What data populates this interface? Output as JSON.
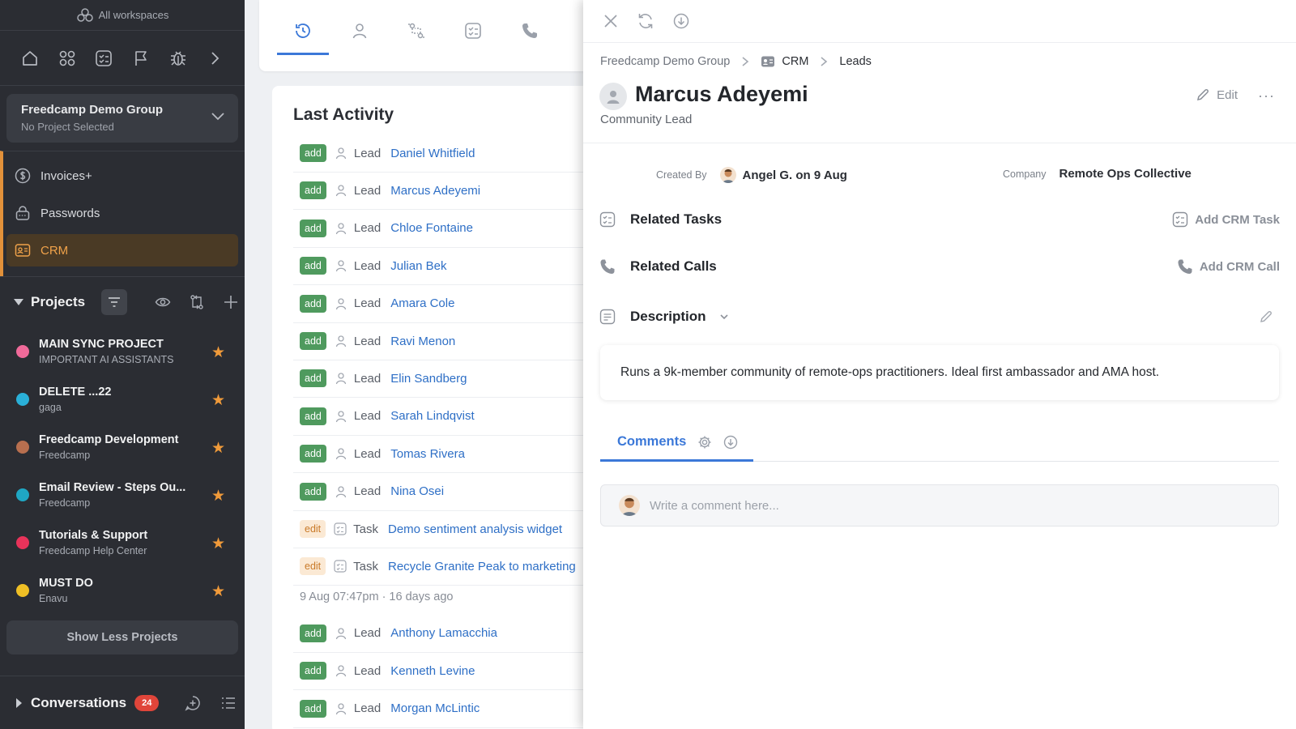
{
  "sidebar": {
    "workspaces_label": "All workspaces",
    "workspace": {
      "name": "Freedcamp Demo Group",
      "project": "No Project Selected"
    },
    "apps": [
      {
        "label": "Invoices+",
        "icon": "dollar-icon"
      },
      {
        "label": "Passwords",
        "icon": "lock-icon"
      },
      {
        "label": "CRM",
        "icon": "contact-card-icon",
        "active": true
      }
    ],
    "projects_title": "Projects",
    "projects": [
      {
        "name": "MAIN SYNC PROJECT",
        "sub": "IMPORTANT AI ASSISTANTS",
        "color": "#f06a9a"
      },
      {
        "name": "DELETE ...22",
        "sub": "gaga",
        "color": "#2ab0d8"
      },
      {
        "name": "Freedcamp Development",
        "sub": "Freedcamp",
        "color": "#b86f4f"
      },
      {
        "name": "Email Review - Steps Ou...",
        "sub": "Freedcamp",
        "color": "#1fa7c4"
      },
      {
        "name": "Tutorials & Support",
        "sub": "Freedcamp Help Center",
        "color": "#e8335a"
      },
      {
        "name": "MUST DO",
        "sub": "Enavu",
        "color": "#efbf25"
      }
    ],
    "show_less": "Show Less Projects",
    "conversations_title": "Conversations",
    "conversations_count": "24"
  },
  "activity": {
    "title": "Last Activity",
    "rows": [
      {
        "chip": "add",
        "kind": "Lead",
        "name": "Daniel Whitfield"
      },
      {
        "chip": "add",
        "kind": "Lead",
        "name": "Marcus Adeyemi"
      },
      {
        "chip": "add",
        "kind": "Lead",
        "name": "Chloe Fontaine"
      },
      {
        "chip": "add",
        "kind": "Lead",
        "name": "Julian Bek"
      },
      {
        "chip": "add",
        "kind": "Lead",
        "name": "Amara Cole"
      },
      {
        "chip": "add",
        "kind": "Lead",
        "name": "Ravi Menon"
      },
      {
        "chip": "add",
        "kind": "Lead",
        "name": "Elin Sandberg"
      },
      {
        "chip": "add",
        "kind": "Lead",
        "name": "Sarah Lindqvist"
      },
      {
        "chip": "add",
        "kind": "Lead",
        "name": "Tomas Rivera"
      },
      {
        "chip": "add",
        "kind": "Lead",
        "name": "Nina Osei"
      },
      {
        "chip": "edit",
        "kind": "Task",
        "name": "Demo sentiment analysis widget"
      },
      {
        "chip": "edit",
        "kind": "Task",
        "name": "Recycle Granite Peak to marketing"
      }
    ],
    "timestamp": "9 Aug 07:47pm · 16 days ago",
    "rows2": [
      {
        "chip": "add",
        "kind": "Lead",
        "name": "Anthony Lamacchia"
      },
      {
        "chip": "add",
        "kind": "Lead",
        "name": "Kenneth Levine"
      },
      {
        "chip": "add",
        "kind": "Lead",
        "name": "Morgan McLintic"
      }
    ]
  },
  "lead": {
    "breadcrumb": [
      "Freedcamp Demo Group",
      "CRM",
      "Leads"
    ],
    "name": "Marcus Adeyemi",
    "role": "Community Lead",
    "edit_label": "Edit",
    "created_by_label": "Created By",
    "created_by": "Angel G. on 9 Aug",
    "company_label": "Company",
    "company": "Remote Ops Collective",
    "related_tasks": "Related Tasks",
    "add_task": "Add CRM Task",
    "related_calls": "Related Calls",
    "add_call": "Add CRM Call",
    "description_title": "Description",
    "description": "Runs a 9k-member community of remote-ops practitioners. Ideal first ambassador and AMA host.",
    "comments_tab": "Comments",
    "comment_placeholder": "Write a comment here..."
  },
  "colors": {
    "accent": "#3b78d8",
    "crm_active": "#f0a24a",
    "add_chip": "#4f9a5e",
    "edit_chip": "#fbe9d4"
  }
}
